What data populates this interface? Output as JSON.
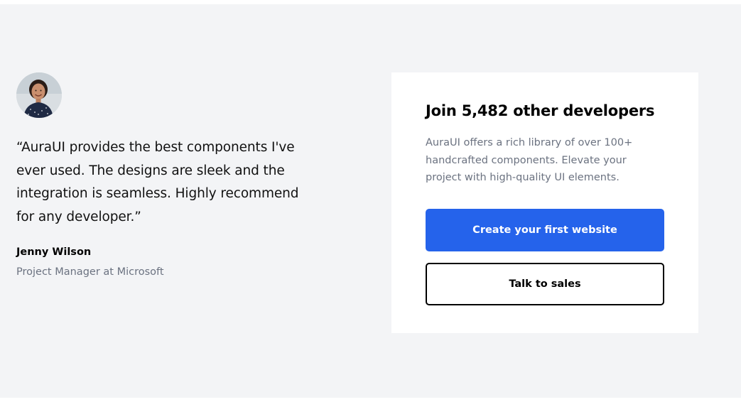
{
  "testimonial": {
    "avatar_icon": "person-avatar-photo",
    "quote": "“AuraUI provides the best components I've ever used. The designs are sleek and the integration is seamless. Highly recommend for any developer.”",
    "author_name": "Jenny Wilson",
    "author_role": "Project Manager at Microsoft"
  },
  "cta": {
    "title": "Join 5,482 other developers",
    "description": "AuraUI offers a rich library of over 100+ handcrafted components. Elevate your project with high-quality UI elements.",
    "primary_button_label": "Create your first website",
    "secondary_button_label": "Talk to sales"
  },
  "colors": {
    "section_bg": "#f3f4f6",
    "card_bg": "#ffffff",
    "primary": "#2563eb",
    "muted_text": "#6b7280"
  }
}
